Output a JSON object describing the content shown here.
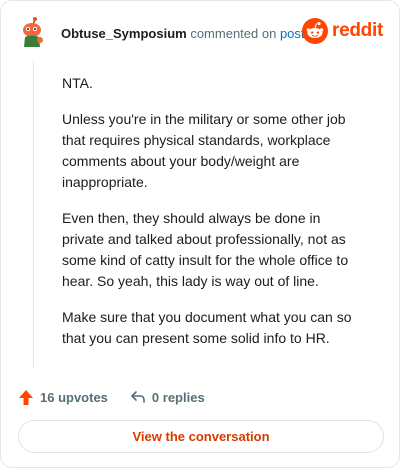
{
  "header": {
    "username": "Obtuse_Symposium",
    "commented_text": "commented on",
    "post_link": "post",
    "brand": "reddit",
    "avatar_icon": "snoo-avatar-icon",
    "logo_icon": "reddit-alien-icon"
  },
  "comment": {
    "paragraphs": [
      "NTA.",
      "Unless you're in the military or some other job that requires physical standards, workplace comments about your body/weight are inappropriate.",
      "Even then, they should always be done in private and talked about professionally, not as some kind of catty insult for the whole office to hear. So yeah, this lady is way out of line.",
      "Make sure that you document what you can so that you can present some solid info to HR."
    ]
  },
  "actions": {
    "upvotes": "16 upvotes",
    "replies": "0 replies",
    "upvote_icon": "upvote-arrow-icon",
    "reply_icon": "reply-arrow-icon"
  },
  "cta": {
    "label": "View the conversation"
  },
  "colors": {
    "brand": "#ff4500",
    "link": "#0a6dc2",
    "muted": "#576f76",
    "cta": "#d93a00"
  }
}
